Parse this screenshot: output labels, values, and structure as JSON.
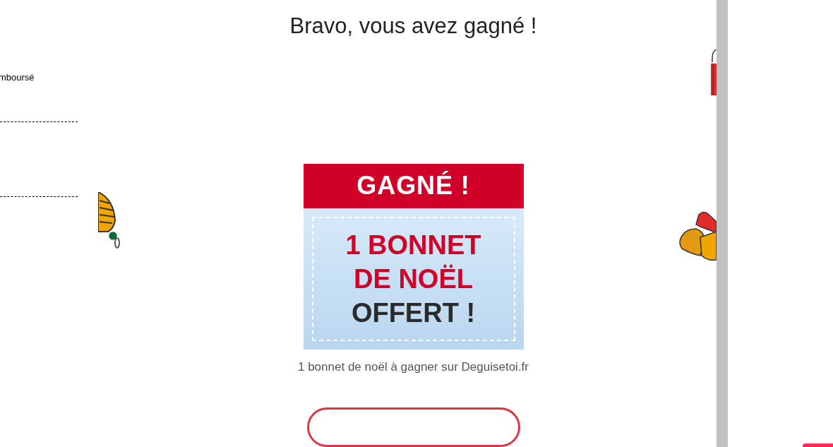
{
  "side_panel": {
    "text": "mboursé"
  },
  "title": "Bravo, vous avez gagné !",
  "prize_card": {
    "header": "GAGNÉ !",
    "lines": [
      {
        "text": "1 BONNET",
        "kind": "accent"
      },
      {
        "text": "DE NOËL",
        "kind": "accent"
      },
      {
        "text": "OFFERT !",
        "kind": "plain"
      }
    ]
  },
  "caption": "1 bonnet de noël à gagner sur Deguisetoi.fr"
}
